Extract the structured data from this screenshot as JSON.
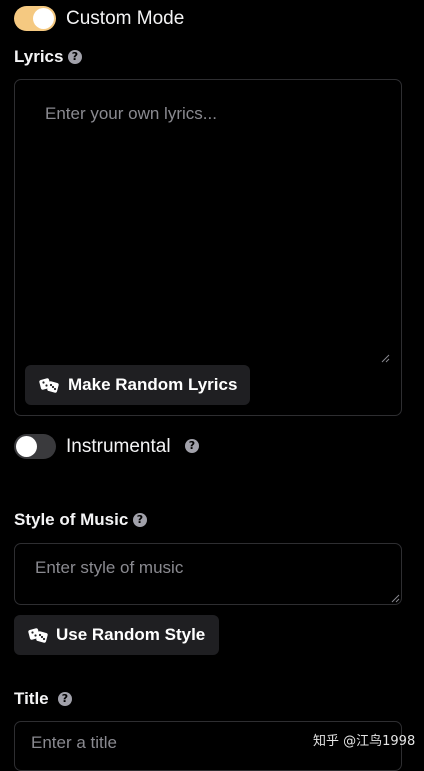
{
  "custom_mode": {
    "label": "Custom Mode",
    "enabled": true
  },
  "lyrics": {
    "label": "Lyrics",
    "help_icon": "question-circle-icon",
    "placeholder": "Enter your own lyrics...",
    "random_button_label": "Make Random Lyrics",
    "random_button_icon": "dice-icon"
  },
  "instrumental": {
    "label": "Instrumental",
    "enabled": false,
    "help_icon": "question-circle-icon"
  },
  "style_of_music": {
    "label": "Style of Music",
    "help_icon": "question-circle-icon",
    "placeholder": "Enter style of music",
    "random_button_label": "Use Random Style",
    "random_button_icon": "dice-icon"
  },
  "title": {
    "label": "Title",
    "help_icon": "question-circle-icon",
    "placeholder": "Enter a title"
  },
  "watermark": {
    "text": "知乎 @江鸟1998"
  },
  "colors": {
    "background": "#000000",
    "toggle_on": "#f5c981",
    "toggle_off": "#3a3a3d",
    "button_bg": "#1f1f22",
    "field_border": "#2e2e31",
    "placeholder": "#8a8a90"
  }
}
